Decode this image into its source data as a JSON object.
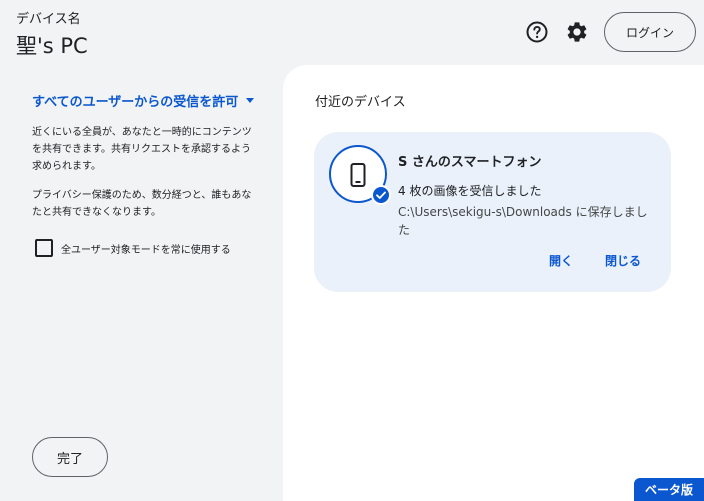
{
  "header": {
    "label": "デバイス名",
    "device_name": "聖's PC",
    "help_icon": "help-circle-icon",
    "settings_icon": "gear-icon",
    "login_label": "ログイン"
  },
  "left_panel": {
    "visibility_label": "すべてのユーザーからの受信を許可",
    "description_1": "近くにいる全員が、あなたと一時的にコンテンツを共有できます。共有リクエストを承認するよう求められます。",
    "description_2": "プライバシー保護のため、数分経つと、誰もあなたと共有できなくなります。",
    "checkbox_label": "全ユーザー対象モードを常に使用する",
    "checkbox_checked": false,
    "done_label": "完了"
  },
  "right_panel": {
    "title": "付近のデバイス",
    "device": {
      "name": "S さんのスマートフォン",
      "status": "4 枚の画像を受信しました",
      "path": "C:\\Users\\sekigu-s\\Downloads に保存しました",
      "open_label": "開く",
      "close_label": "閉じる",
      "icon": "smartphone-icon"
    }
  },
  "beta_label": "ベータ版",
  "colors": {
    "accent": "#0b57d0",
    "background": "#f1f3f4",
    "card": "#eaf1fb"
  }
}
